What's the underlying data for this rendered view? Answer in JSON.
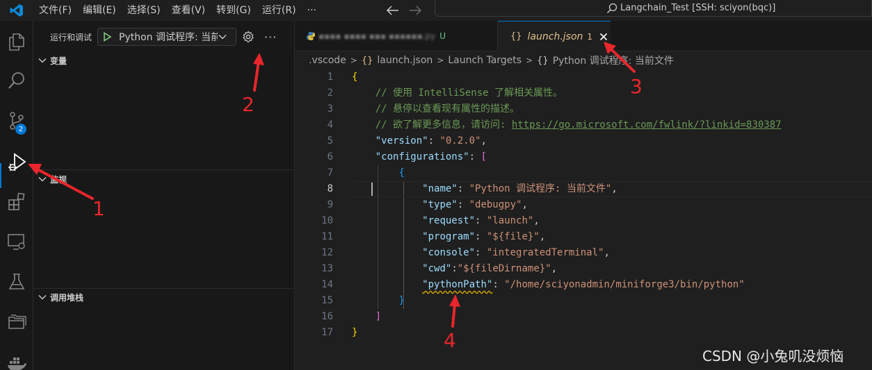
{
  "menu": [
    "文件(F)",
    "编辑(E)",
    "选择(S)",
    "查看(V)",
    "转到(G)",
    "运行(R)",
    "···"
  ],
  "command_center": "Langchain_Test [SSH: sciyon(bqc)]",
  "activity": {
    "badge": "2",
    "icons": [
      "explorer-icon",
      "search-icon",
      "source-control-icon",
      "run-debug-icon",
      "extensions-icon",
      "remote-explorer-icon",
      "testing-icon",
      "folders-icon",
      "docker-icon"
    ]
  },
  "sidebar": {
    "run_label": "运行和调试",
    "config_name": "Python 调试程序: 当前文件",
    "more": "···",
    "sections": [
      "变量",
      "监视",
      "调用堆栈"
    ]
  },
  "tabs": {
    "tab1_name": "▪▪▪▪ ▪▪▪▪ ▪▪▪ ▪▪▪▪▪▪.py",
    "tab1_status": "U",
    "tab2_icon": "{}",
    "tab2_name": "launch.json",
    "tab2_problems": "1"
  },
  "breadcrumb": [
    ".vscode",
    "launch.json",
    "Launch Targets",
    "Python 调试程序: 当前文件"
  ],
  "code": {
    "line_numbers": [
      "1",
      "2",
      "3",
      "4",
      "5",
      "6",
      "7",
      "8",
      "9",
      "10",
      "11",
      "12",
      "13",
      "14",
      "15",
      "16",
      "17"
    ],
    "l1": "{",
    "l2": "// 使用 IntelliSense 了解相关属性。",
    "l3": "// 悬停以查看现有属性的描述。",
    "l4a": "// 欲了解更多信息，请访问: ",
    "l4b": "https://go.microsoft.com/fwlink/?linkid=830387",
    "l5k": "\"version\"",
    "l5s": "\"0.2.0\"",
    "l6k": "\"configurations\"",
    "l6b": "[",
    "l7": "{",
    "l8k": "\"name\"",
    "l8s": "\"Python 调试程序: 当前文件\"",
    "l9k": "\"type\"",
    "l9s": "\"debugpy\"",
    "l10k": "\"request\"",
    "l10s": "\"launch\"",
    "l11k": "\"program\"",
    "l11s": "\"${file}\"",
    "l12k": "\"console\"",
    "l12s": "\"integratedTerminal\"",
    "l13k": "\"cwd\"",
    "l13s": "\"${fileDirname}\"",
    "l14k": "\"pythonPath\"",
    "l14s": "\"/home/sciyonadmin/miniforge3/bin/python\"",
    "l15": "}",
    "l16": "]",
    "l17": "}"
  },
  "annotations": [
    "1",
    "2",
    "3",
    "4"
  ],
  "watermark": "CSDN @小兔叽没烦恼",
  "colors": {
    "accent": "#0078d4",
    "annotation": "#e8262b",
    "string": "#ce9178",
    "key": "#9cdcfe",
    "comment": "#6a9955"
  }
}
